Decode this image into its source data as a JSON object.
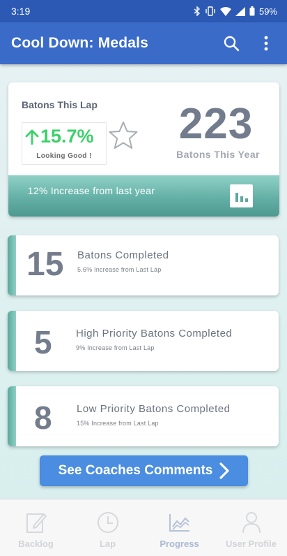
{
  "status_bar": {
    "time": "3:19",
    "battery": "59%"
  },
  "app_bar": {
    "title": "Cool Down: Medals"
  },
  "summary": {
    "lap_label": "Batons This Lap",
    "lap_percent": "15.7%",
    "lap_status": "Looking Good !",
    "year_count": "223",
    "year_label": "Batons This Year",
    "band_text": "12% Increase from last year"
  },
  "stats": [
    {
      "number": "15",
      "title": "Batons Completed",
      "subtitle": "5.6% Increase from Last Lap"
    },
    {
      "number": "5",
      "title": "High Priority Batons Completed",
      "subtitle": "9% Increase from Last Lap"
    },
    {
      "number": "8",
      "title": "Low Priority Batons Completed",
      "subtitle": "15% Increase from Last Lap"
    }
  ],
  "comments_button": {
    "label": "See Coaches Comments"
  },
  "bottom_nav": {
    "items": [
      {
        "label": "Backlog",
        "icon": "edit-icon"
      },
      {
        "label": "Lap",
        "icon": "clock-icon"
      },
      {
        "label": "Progress",
        "icon": "line-chart-icon"
      },
      {
        "label": "User Profile",
        "icon": "person-icon"
      }
    ],
    "active": "Progress"
  },
  "colors": {
    "status_bar": "#2c59b3",
    "app_bar": "#3a6bc9",
    "positive_green": "#3bd16a",
    "teal_accent": "#64b0a6",
    "button_blue": "#4a8de1"
  }
}
